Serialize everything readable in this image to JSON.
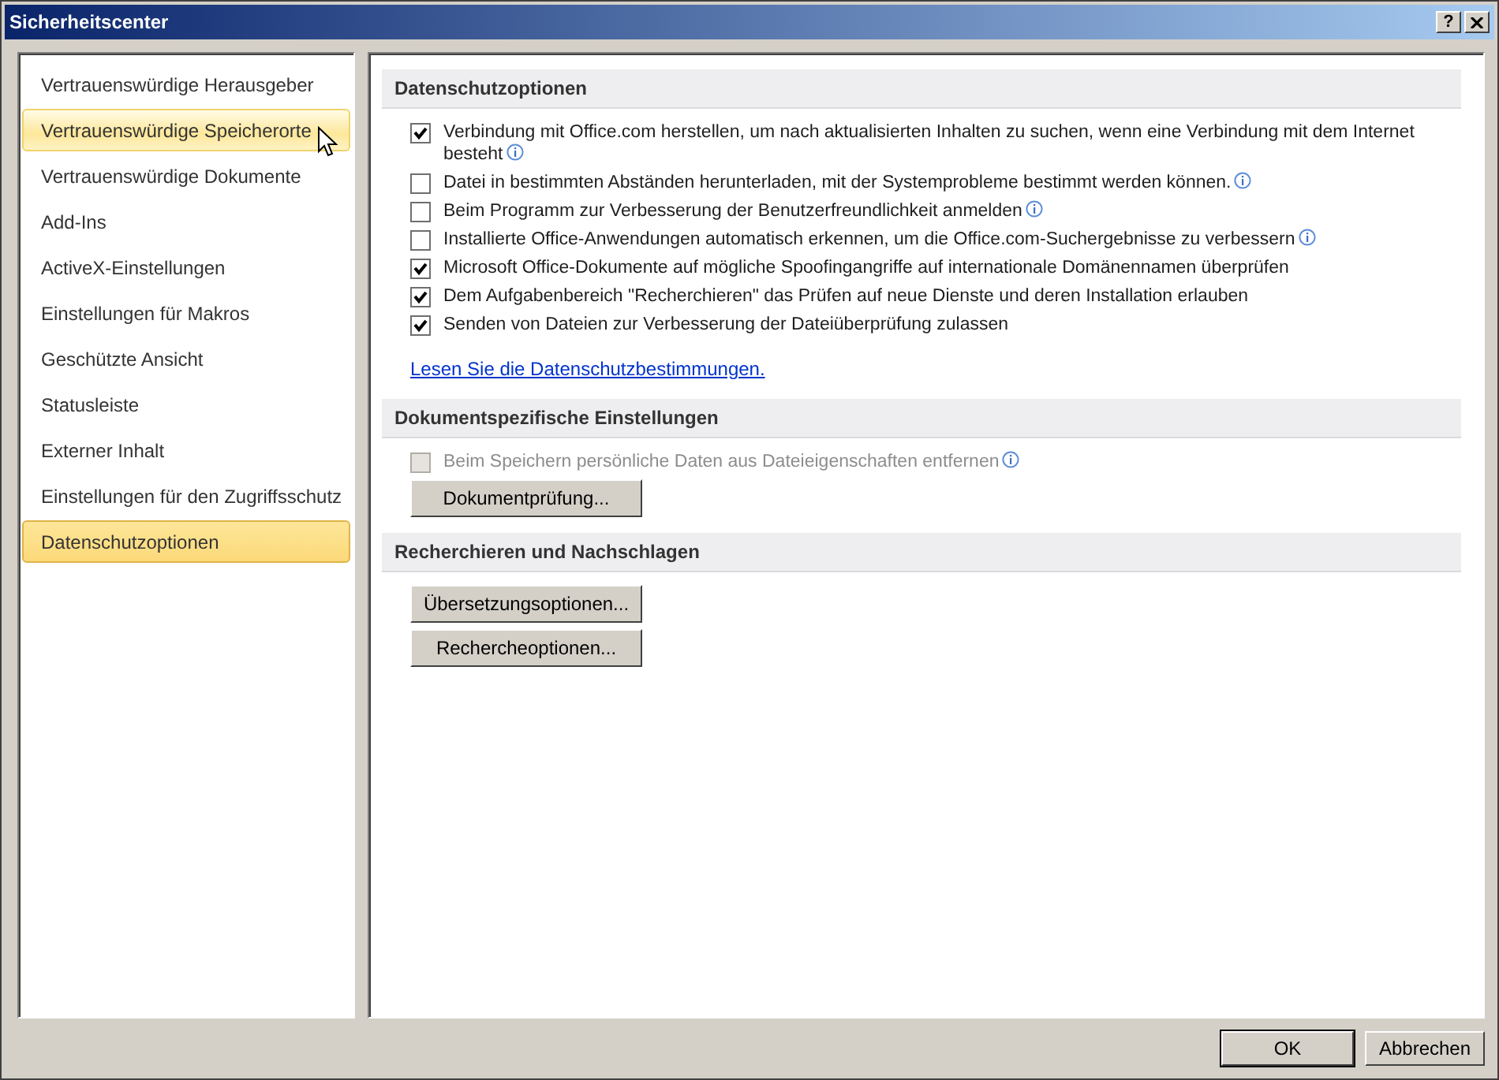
{
  "window": {
    "title": "Sicherheitscenter",
    "help": "?"
  },
  "sidebar": {
    "items": [
      {
        "label": "Vertrauenswürdige Herausgeber",
        "selected": false,
        "hovered": false
      },
      {
        "label": "Vertrauenswürdige Speicherorte",
        "selected": false,
        "hovered": true
      },
      {
        "label": "Vertrauenswürdige Dokumente",
        "selected": false,
        "hovered": false
      },
      {
        "label": "Add-Ins",
        "selected": false,
        "hovered": false
      },
      {
        "label": "ActiveX-Einstellungen",
        "selected": false,
        "hovered": false
      },
      {
        "label": "Einstellungen für Makros",
        "selected": false,
        "hovered": false
      },
      {
        "label": "Geschützte Ansicht",
        "selected": false,
        "hovered": false
      },
      {
        "label": "Statusleiste",
        "selected": false,
        "hovered": false
      },
      {
        "label": "Externer Inhalt",
        "selected": false,
        "hovered": false
      },
      {
        "label": "Einstellungen für den Zugriffsschutz",
        "selected": false,
        "hovered": false
      },
      {
        "label": "Datenschutzoptionen",
        "selected": true,
        "hovered": false
      }
    ]
  },
  "sections": [
    {
      "title": "Datenschutzoptionen",
      "items": [
        {
          "kind": "checkbox",
          "label": "Verbindung mit Office.com herstellen, um nach aktualisierten Inhalten zu suchen, wenn eine Verbindung mit dem Internet besteht",
          "checked": true,
          "disabled": false,
          "info": true
        },
        {
          "kind": "checkbox",
          "label": "Datei in bestimmten Abständen herunterladen, mit der Systemprobleme bestimmt werden können.",
          "checked": false,
          "disabled": false,
          "info": true
        },
        {
          "kind": "checkbox",
          "label": "Beim Programm zur Verbesserung der Benutzerfreundlichkeit anmelden",
          "checked": false,
          "disabled": false,
          "info": true
        },
        {
          "kind": "checkbox",
          "label": "Installierte Office-Anwendungen automatisch erkennen, um die Office.com-Suchergebnisse zu verbessern",
          "checked": false,
          "disabled": false,
          "info": true
        },
        {
          "kind": "checkbox",
          "label": "Microsoft Office-Dokumente auf mögliche Spoofingangriffe auf internationale Domänennamen überprüfen",
          "checked": true,
          "disabled": false,
          "info": false
        },
        {
          "kind": "checkbox",
          "label": "Dem Aufgabenbereich \"Recherchieren\" das Prüfen auf neue Dienste und deren Installation erlauben",
          "checked": true,
          "disabled": false,
          "info": false
        },
        {
          "kind": "checkbox",
          "label": "Senden von Dateien zur Verbesserung der Dateiüberprüfung zulassen",
          "checked": true,
          "disabled": false,
          "info": false
        },
        {
          "kind": "link",
          "label": "Lesen Sie die Datenschutzbestimmungen."
        }
      ]
    },
    {
      "title": "Dokumentspezifische Einstellungen",
      "items": [
        {
          "kind": "checkbox",
          "label": "Beim Speichern persönliche Daten aus Dateieigenschaften entfernen",
          "checked": false,
          "disabled": true,
          "info": true
        },
        {
          "kind": "button",
          "label": "Dokumentprüfung..."
        }
      ]
    },
    {
      "title": "Recherchieren und Nachschlagen",
      "items": [
        {
          "kind": "button",
          "label": "Übersetzungsoptionen..."
        },
        {
          "kind": "button",
          "label": "Rechercheoptionen..."
        }
      ]
    }
  ],
  "footer": {
    "buttons": [
      {
        "label": "OK",
        "default": true
      },
      {
        "label": "Abbrechen",
        "default": false
      }
    ]
  }
}
